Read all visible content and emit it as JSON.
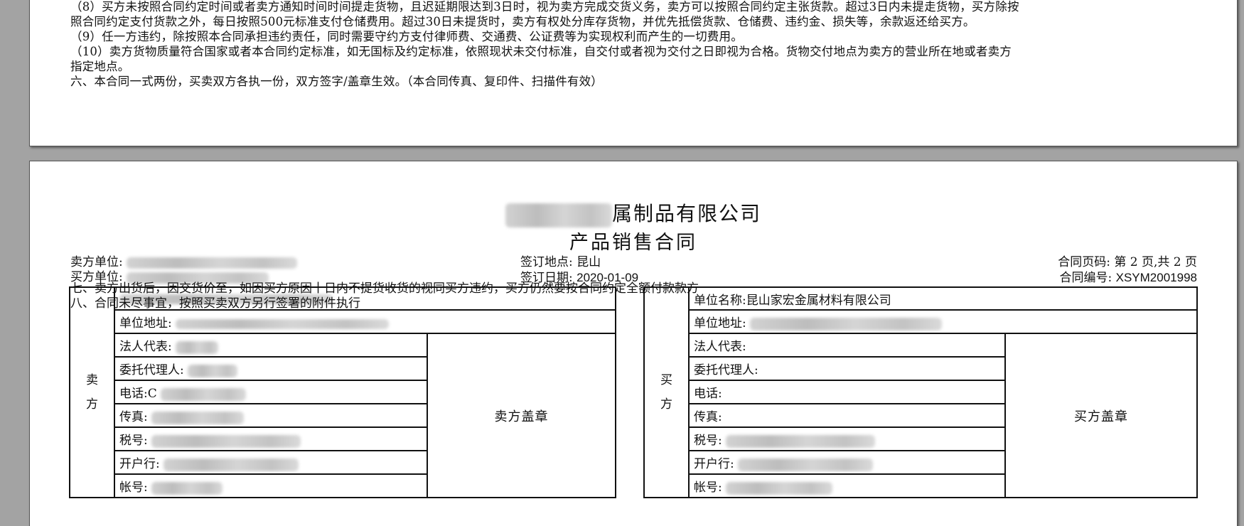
{
  "page1": {
    "clauses": [
      "（8）买方未按照合同约定时间或者卖方通知时间时间提走货物，且迟延期限达到3日时，视为卖方完成交货义务，卖方可以按照合同约定主张货款。超过3日内未提走货物，买方除按",
      "照合同约定支付货款之外，每日按照500元标准支付仓储费用。超过30日未提货时，卖方有权处分库存货物，并优先抵偿货款、仓储费、违约金、损失等，余款返还给买方。",
      "（9）任一方违约，除按照本合同承担违约责任，同时需要守约方支付律师费、交通费、公证费等为实现权利而产生的一切费用。",
      "（10）卖方货物质量符合国家或者本合同约定标准，如无国标及约定标准，依照现状未交付标准，自交付或者视为交付之日即视为合格。货物交付地点为卖方的营业所在地或者卖方",
      "指定地点。",
      "六、本合同一式两份，买卖双方各执一份，双方签字/盖章生效。（本合同传真、复印件、扫描件有效）"
    ]
  },
  "page2": {
    "company_name_visible": "属制品有限公司",
    "doc_title": "产品销售合同",
    "seller_unit_label": "卖方单位:",
    "buyer_unit_label": "买方单位:",
    "sign_place_label": "签订地点:",
    "sign_place": "昆山",
    "sign_date_label": "签订日期:",
    "sign_date": "2020-01-09",
    "page_no_label": "合同页码:",
    "page_no": "第 2 页,共 2 页",
    "contract_no_label": "合同编号:",
    "contract_no": "XSYM2001998",
    "overlay_lines": [
      "七、卖方出货后，因交货价至，如因买方原因十日内不提货收货的视同买方违约，买方仍然要按合同约定全额付款款方",
      "八、合同未尽事宜，按照买卖双方另行签署的附件执行"
    ],
    "seller_table": {
      "side_label_1": "卖",
      "side_label_2": "方",
      "unit_addr_label": "单位地址:",
      "legal_rep_label": "法人代表:",
      "agent_label": "委托代理人:",
      "phone_label": "电话:",
      "phone_partial": "C",
      "fax_label": "传真:",
      "tax_label": "税号:",
      "bank_label": "开户行:",
      "account_label": "帐号:",
      "stamp_label": "卖方盖章"
    },
    "buyer_table": {
      "side_label_1": "买",
      "side_label_2": "方",
      "unit_name_label": "单位名称:",
      "unit_name": "昆山家宏金属材料有限公司",
      "unit_addr_label": "单位地址:",
      "legal_rep_label": "法人代表:",
      "agent_label": "委托代理人:",
      "phone_label": "电话:",
      "fax_label": "传真:",
      "tax_label": "税号:",
      "bank_label": "开户行:",
      "account_label": "帐号:",
      "stamp_label": "买方盖章"
    }
  }
}
